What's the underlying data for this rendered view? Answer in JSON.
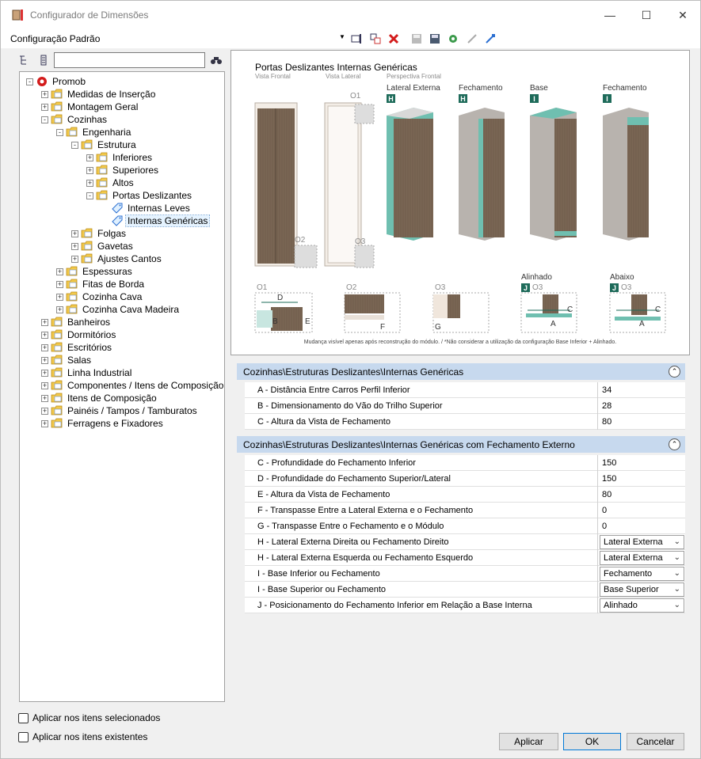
{
  "window": {
    "title": "Configurador de Dimensões",
    "min_glyph": "—",
    "max_glyph": "☐",
    "close_glyph": "✕"
  },
  "toolbar": {
    "config_label": "Configuração Padrão",
    "dropdown_glyph": "▼"
  },
  "left": {
    "search_value": "",
    "tree": [
      {
        "label": "Promob",
        "icon": "promob-logo-icon",
        "exp": "-"
      },
      {
        "label": "Medidas de Inserção",
        "icon": "folder-icon",
        "exp": "+"
      },
      {
        "label": "Montagem Geral",
        "icon": "folder-icon",
        "exp": "+"
      },
      {
        "label": "Cozinhas",
        "icon": "folder-icon",
        "exp": "-"
      },
      {
        "label": "Engenharia",
        "icon": "folder-icon",
        "exp": "-"
      },
      {
        "label": "Estrutura",
        "icon": "folder-icon",
        "exp": "-"
      },
      {
        "label": "Inferiores",
        "icon": "folder-icon",
        "exp": "+"
      },
      {
        "label": "Superiores",
        "icon": "folder-icon",
        "exp": "+"
      },
      {
        "label": "Altos",
        "icon": "folder-icon",
        "exp": "+"
      },
      {
        "label": "Portas Deslizantes",
        "icon": "folder-icon",
        "exp": "-"
      },
      {
        "label": "Internas Leves",
        "icon": "tag-icon",
        "exp": ""
      },
      {
        "label": "Internas Genéricas",
        "icon": "tag-icon",
        "exp": ""
      },
      {
        "label": "Folgas",
        "icon": "folder-icon",
        "exp": "+"
      },
      {
        "label": "Gavetas",
        "icon": "folder-icon",
        "exp": "+"
      },
      {
        "label": "Ajustes Cantos",
        "icon": "folder-icon",
        "exp": "+"
      },
      {
        "label": "Espessuras",
        "icon": "folder-icon",
        "exp": "+"
      },
      {
        "label": "Fitas de Borda",
        "icon": "folder-icon",
        "exp": "+"
      },
      {
        "label": "Cozinha Cava",
        "icon": "folder-icon",
        "exp": "+"
      },
      {
        "label": "Cozinha Cava Madeira",
        "icon": "folder-icon",
        "exp": "+"
      },
      {
        "label": "Banheiros",
        "icon": "folder-icon",
        "exp": "+"
      },
      {
        "label": "Dormitórios",
        "icon": "folder-icon",
        "exp": "+"
      },
      {
        "label": "Escritórios",
        "icon": "folder-icon",
        "exp": "+"
      },
      {
        "label": "Salas",
        "icon": "folder-icon",
        "exp": "+"
      },
      {
        "label": "Linha Industrial",
        "icon": "folder-icon",
        "exp": "+"
      },
      {
        "label": "Componentes / Itens de Composição",
        "icon": "folder-icon",
        "exp": "+"
      },
      {
        "label": "Itens de Composição",
        "icon": "folder-icon",
        "exp": "+"
      },
      {
        "label": "Painéis / Tampos / Tamburatos",
        "icon": "folder-icon",
        "exp": "+"
      },
      {
        "label": "Ferragens e Fixadores",
        "icon": "folder-icon",
        "exp": "+"
      }
    ],
    "apply_selected": "Aplicar nos itens selecionados",
    "apply_existing": "Aplicar nos itens existentes"
  },
  "image": {
    "title": "Portas Deslizantes Internas Genéricas",
    "vista_frontal": "Vista Frontal",
    "vista_lateral": "Vista Lateral",
    "perspectiva": "Perspectiva Frontal",
    "lateral_externa": "Lateral Externa",
    "fechamento_1": "Fechamento",
    "base": "Base",
    "fechamento_2": "Fechamento",
    "badge_h1": "H",
    "badge_h2": "H",
    "badge_i1": "I",
    "badge_i2": "I",
    "o1_top": "O1",
    "o2_top": "O2",
    "o3_top": "O3",
    "o1": "O1",
    "o2": "O2",
    "o3": "O3",
    "alinhado": "Alinhado",
    "abaixo": "Abaixo",
    "badge_j1": "J",
    "badge_j2": "J",
    "o3_j1": "O3",
    "o3_j2": "O3",
    "d_label": "D",
    "b_label": "B",
    "e_label": "E",
    "f_label": "F",
    "g_label": "G",
    "c_label_1": "C",
    "a_label_1": "A",
    "c_label_2": "C",
    "a_label_2": "A",
    "note": "Mudança visível apenas após reconstrução do módulo. / *Não considerar a utilização da configuração Base Inferior + Alinhado."
  },
  "groups": [
    {
      "title": "Cozinhas\\Estruturas Deslizantes\\Internas Genéricas",
      "rows": [
        {
          "name": "A - Distância Entre Carros Perfil Inferior",
          "value": "34",
          "dd": false
        },
        {
          "name": "B - Dimensionamento do Vão do Trilho Superior",
          "value": "28",
          "dd": false
        },
        {
          "name": "C - Altura da Vista de Fechamento",
          "value": "80",
          "dd": false
        }
      ]
    },
    {
      "title": "Cozinhas\\Estruturas Deslizantes\\Internas Genéricas com Fechamento Externo",
      "rows": [
        {
          "name": "C - Profundidade do Fechamento Inferior",
          "value": "150",
          "dd": false
        },
        {
          "name": "D - Profundidade do Fechamento Superior/Lateral",
          "value": "150",
          "dd": false
        },
        {
          "name": "E - Altura da Vista de Fechamento",
          "value": "80",
          "dd": false
        },
        {
          "name": "F - Transpasse Entre a Lateral Externa e o Fechamento",
          "value": "0",
          "dd": false
        },
        {
          "name": "G - Transpasse Entre o Fechamento e o Módulo",
          "value": "0",
          "dd": false
        },
        {
          "name": "H - Lateral Externa Direita ou Fechamento Direito",
          "value": "Lateral Externa",
          "dd": true
        },
        {
          "name": "H - Lateral Externa Esquerda ou Fechamento Esquerdo",
          "value": "Lateral Externa",
          "dd": true
        },
        {
          "name": "I - Base Inferior ou Fechamento",
          "value": "Fechamento",
          "dd": true
        },
        {
          "name": "I - Base Superior ou Fechamento",
          "value": "Base Superior",
          "dd": true
        },
        {
          "name": "J - Posicionamento do Fechamento Inferior em Relação a Base Interna",
          "value": "Alinhado",
          "dd": true
        }
      ]
    }
  ],
  "buttons": {
    "apply": "Aplicar",
    "ok": "OK",
    "cancel": "Cancelar"
  },
  "colors": {
    "teal": "#6fbfb0",
    "wood": "#7a6654",
    "group_header": "#c7d9ee",
    "badge": "#1e6b5a"
  }
}
